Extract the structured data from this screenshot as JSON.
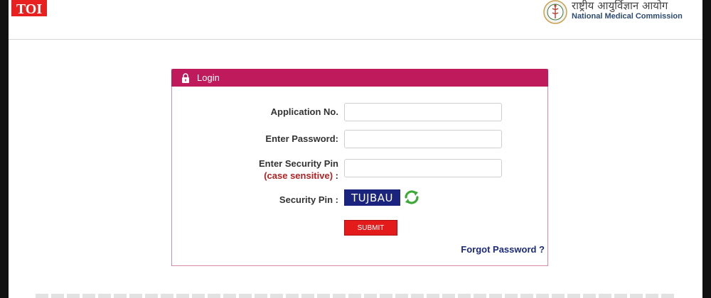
{
  "header": {
    "brand_logo_text": "TOI",
    "nmc_hindi": "राष्ट्रीय आयुर्विज्ञान आयोग",
    "nmc_english": "National Medical Commission"
  },
  "login": {
    "title": "Login",
    "application_label": "Application No.",
    "application_value": "",
    "password_label": "Enter Password:",
    "password_value": "",
    "security_pin_label": "Enter Security Pin",
    "case_sensitive_label": "(case sensitive)",
    "case_sensitive_colon": " :",
    "security_pin_value": "",
    "captcha_label": "Security Pin :",
    "captcha_text": "TUJBAU",
    "submit_label": "SUBMIT",
    "forgot_label": "Forgot Password ?"
  },
  "colors": {
    "header_bar": "#bf1a5b",
    "submit_button": "#e31b1b",
    "captcha_bg": "#1a237e",
    "link": "#1b2a7a",
    "refresh_icon": "#3aa935"
  },
  "icons": [
    "lock-icon",
    "refresh-icon",
    "nmc-emblem-icon"
  ]
}
